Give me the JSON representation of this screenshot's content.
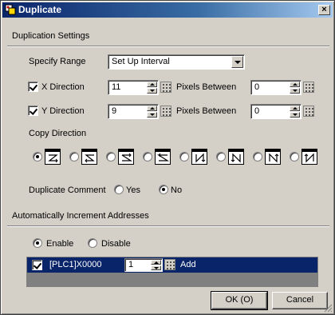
{
  "window": {
    "title": "Duplicate",
    "close_glyph": "×"
  },
  "duplication_settings": {
    "section_label": "Duplication Settings",
    "specify_range_label": "Specify Range",
    "specify_range_value": "Set Up Interval",
    "x_direction": {
      "label": "X Direction",
      "checked": true,
      "value": "11",
      "pixels_between_label": "Pixels Between",
      "pixels_between_value": "0"
    },
    "y_direction": {
      "label": "Y Direction",
      "checked": true,
      "value": "9",
      "pixels_between_label": "Pixels Between",
      "pixels_between_value": "0"
    },
    "copy_direction_label": "Copy Direction",
    "copy_direction_selected_index": 0,
    "duplicate_comment_label": "Duplicate Comment",
    "duplicate_comment_yes": "Yes",
    "duplicate_comment_no": "No",
    "duplicate_comment_selected": "No"
  },
  "auto_increment": {
    "section_label": "Automatically Increment Addresses",
    "enable_label": "Enable",
    "disable_label": "Disable",
    "selected": "Enable",
    "rows": [
      {
        "checked": true,
        "address": "[PLC1]X0000",
        "increment": "1",
        "add_label": "Add"
      }
    ]
  },
  "buttons": {
    "ok": "OK (O)",
    "cancel": "Cancel"
  }
}
